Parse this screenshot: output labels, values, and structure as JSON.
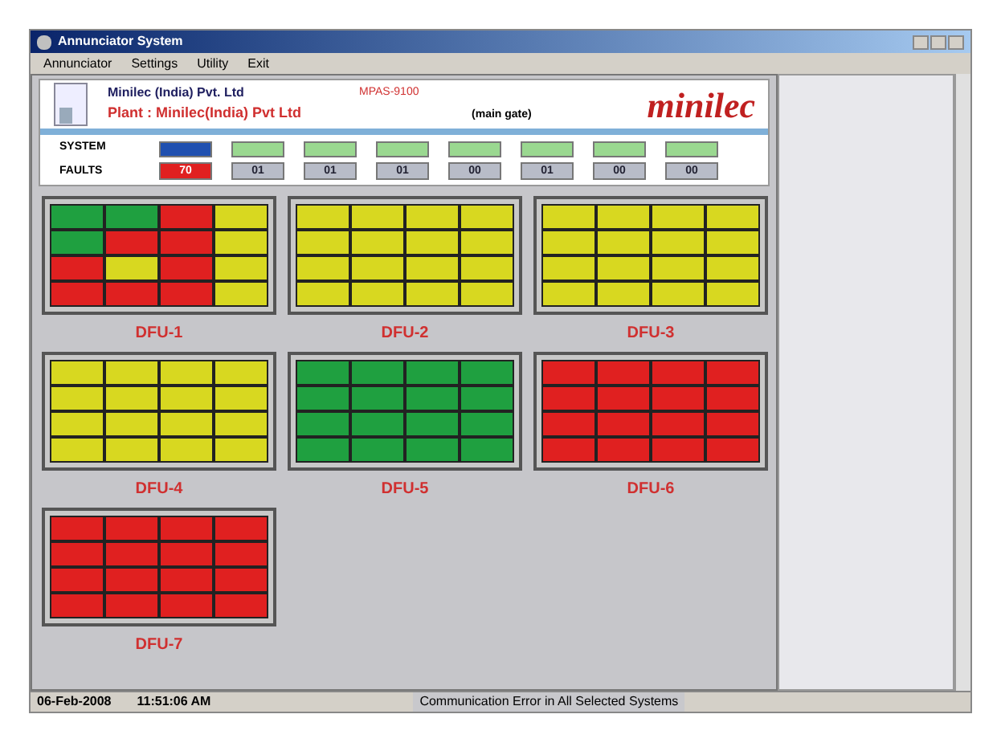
{
  "window": {
    "title": "Annunciator System"
  },
  "menu": [
    "Annunciator",
    "Settings",
    "Utility",
    "Exit"
  ],
  "header": {
    "company": "Minilec (India) Pvt. Ltd",
    "model": "MPAS-9100",
    "plant": "Plant : Minilec(India) Pvt Ltd",
    "location": "(main gate)",
    "logo": "minilec"
  },
  "rows": {
    "system_label": "SYSTEM",
    "faults_label": "FAULTS"
  },
  "systems": [
    {
      "selected": true,
      "fault": "70",
      "fault_alarm": true
    },
    {
      "selected": false,
      "fault": "01",
      "fault_alarm": false
    },
    {
      "selected": false,
      "fault": "01",
      "fault_alarm": false
    },
    {
      "selected": false,
      "fault": "01",
      "fault_alarm": false
    },
    {
      "selected": false,
      "fault": "00",
      "fault_alarm": false
    },
    {
      "selected": false,
      "fault": "01",
      "fault_alarm": false
    },
    {
      "selected": false,
      "fault": "00",
      "fault_alarm": false
    },
    {
      "selected": false,
      "fault": "00",
      "fault_alarm": false
    }
  ],
  "units": [
    {
      "name": "DFU-1",
      "cells": [
        {
          "color": "#1fa040"
        },
        {
          "color": "#1fa040"
        },
        {
          "color": "#e02020"
        },
        {
          "color": "#d8d820"
        },
        {
          "color": "#1fa040"
        },
        {
          "color": "#e02020"
        },
        {
          "color": "#e02020"
        },
        {
          "color": "#d8d820"
        },
        {
          "color": "#e02020"
        },
        {
          "color": "#d8d820"
        },
        {
          "color": "#e02020"
        },
        {
          "color": "#d8d820"
        },
        {
          "color": "#e02020"
        },
        {
          "color": "#e02020"
        },
        {
          "color": "#e02020"
        },
        {
          "color": "#d8d820"
        }
      ]
    },
    {
      "name": "DFU-2",
      "cells": [
        {
          "color": "#d8d820"
        },
        {
          "color": "#d8d820"
        },
        {
          "color": "#d8d820"
        },
        {
          "color": "#d8d820"
        },
        {
          "color": "#d8d820"
        },
        {
          "color": "#d8d820"
        },
        {
          "color": "#d8d820"
        },
        {
          "color": "#d8d820"
        },
        {
          "color": "#d8d820"
        },
        {
          "color": "#d8d820"
        },
        {
          "color": "#d8d820"
        },
        {
          "color": "#d8d820"
        },
        {
          "color": "#d8d820"
        },
        {
          "color": "#d8d820"
        },
        {
          "color": "#d8d820"
        },
        {
          "color": "#d8d820"
        }
      ]
    },
    {
      "name": "DFU-3",
      "cells": [
        {
          "color": "#d8d820"
        },
        {
          "color": "#d8d820"
        },
        {
          "color": "#d8d820"
        },
        {
          "color": "#d8d820"
        },
        {
          "color": "#d8d820"
        },
        {
          "color": "#d8d820"
        },
        {
          "color": "#d8d820"
        },
        {
          "color": "#d8d820"
        },
        {
          "color": "#d8d820"
        },
        {
          "color": "#d8d820"
        },
        {
          "color": "#d8d820"
        },
        {
          "color": "#d8d820"
        },
        {
          "color": "#d8d820"
        },
        {
          "color": "#d8d820"
        },
        {
          "color": "#d8d820"
        },
        {
          "color": "#d8d820"
        }
      ]
    },
    {
      "name": "DFU-4",
      "cells": [
        {
          "color": "#d8d820"
        },
        {
          "color": "#d8d820"
        },
        {
          "color": "#d8d820"
        },
        {
          "color": "#d8d820"
        },
        {
          "color": "#d8d820"
        },
        {
          "color": "#d8d820"
        },
        {
          "color": "#d8d820"
        },
        {
          "color": "#d8d820"
        },
        {
          "color": "#d8d820"
        },
        {
          "color": "#d8d820"
        },
        {
          "color": "#d8d820"
        },
        {
          "color": "#d8d820"
        },
        {
          "color": "#d8d820"
        },
        {
          "color": "#d8d820"
        },
        {
          "color": "#d8d820"
        },
        {
          "color": "#d8d820"
        }
      ]
    },
    {
      "name": "DFU-5",
      "cells": [
        {
          "color": "#1fa040"
        },
        {
          "color": "#1fa040"
        },
        {
          "color": "#1fa040"
        },
        {
          "color": "#1fa040"
        },
        {
          "color": "#1fa040"
        },
        {
          "color": "#1fa040"
        },
        {
          "color": "#1fa040"
        },
        {
          "color": "#1fa040"
        },
        {
          "color": "#1fa040"
        },
        {
          "color": "#1fa040"
        },
        {
          "color": "#1fa040"
        },
        {
          "color": "#1fa040"
        },
        {
          "color": "#1fa040"
        },
        {
          "color": "#1fa040"
        },
        {
          "color": "#1fa040"
        },
        {
          "color": "#1fa040"
        }
      ]
    },
    {
      "name": "DFU-6",
      "cells": [
        {
          "color": "#e02020"
        },
        {
          "color": "#e02020"
        },
        {
          "color": "#e02020"
        },
        {
          "color": "#e02020"
        },
        {
          "color": "#e02020"
        },
        {
          "color": "#e02020"
        },
        {
          "color": "#e02020"
        },
        {
          "color": "#e02020"
        },
        {
          "color": "#e02020"
        },
        {
          "color": "#e02020"
        },
        {
          "color": "#e02020"
        },
        {
          "color": "#e02020"
        },
        {
          "color": "#e02020"
        },
        {
          "color": "#e02020"
        },
        {
          "color": "#e02020"
        },
        {
          "color": "#e02020"
        }
      ]
    },
    {
      "name": "DFU-7",
      "cells": [
        {
          "color": "#e02020"
        },
        {
          "color": "#e02020"
        },
        {
          "color": "#e02020"
        },
        {
          "color": "#e02020"
        },
        {
          "color": "#e02020"
        },
        {
          "color": "#e02020"
        },
        {
          "color": "#e02020"
        },
        {
          "color": "#e02020"
        },
        {
          "color": "#e02020"
        },
        {
          "color": "#e02020"
        },
        {
          "color": "#e02020"
        },
        {
          "color": "#e02020"
        },
        {
          "color": "#e02020"
        },
        {
          "color": "#e02020"
        },
        {
          "color": "#e02020"
        },
        {
          "color": "#e02020"
        }
      ]
    }
  ],
  "status_bar": {
    "date": "06-Feb-2008",
    "time": "11:51:06 AM",
    "message": "Communication Error in All Selected Systems"
  }
}
